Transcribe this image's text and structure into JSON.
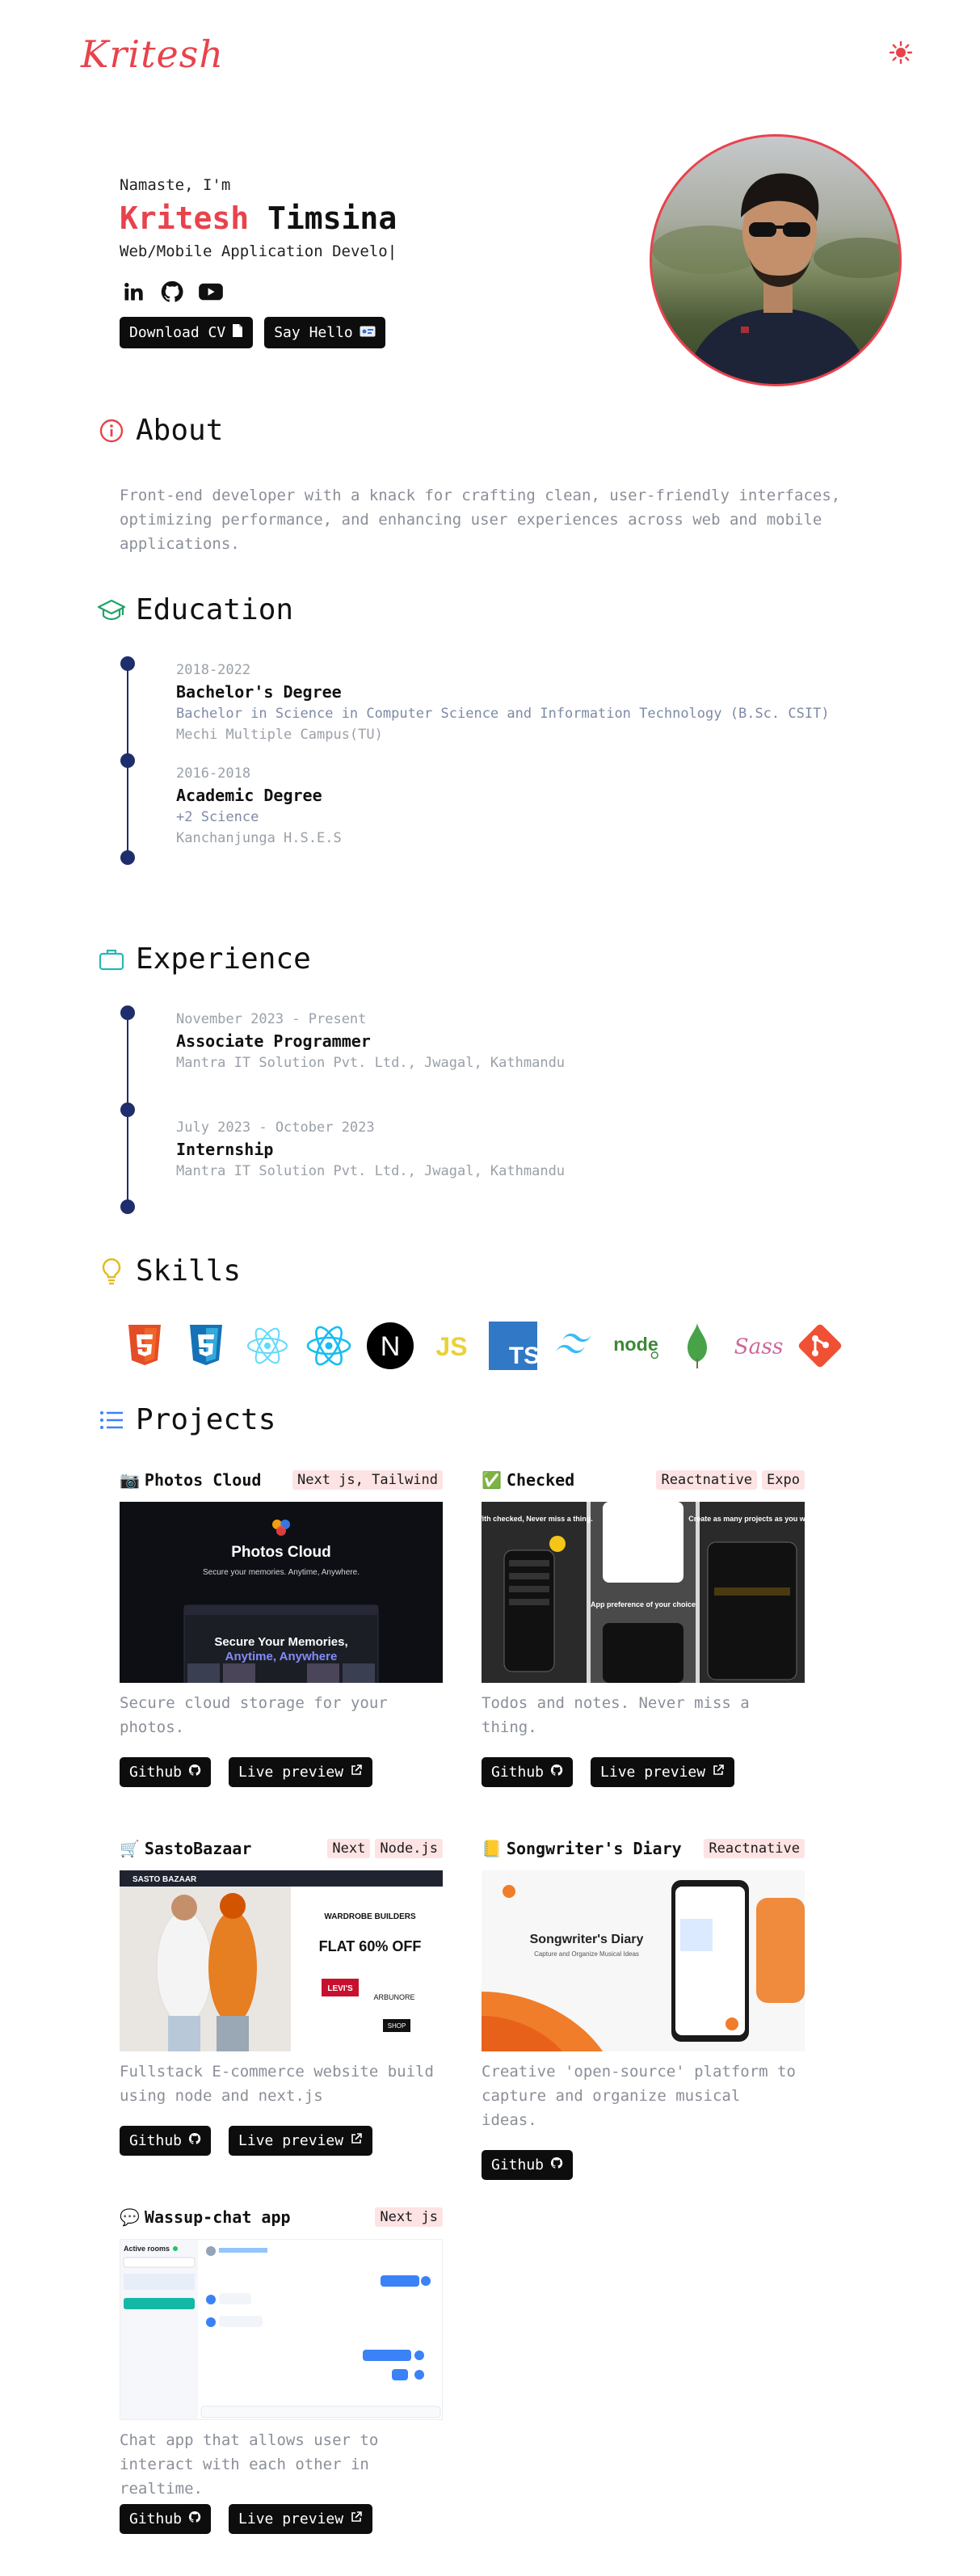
{
  "nav": {
    "logo": "Kritesh",
    "theme_icon": "sun-icon"
  },
  "hero": {
    "greeting": "Namaste, I'm",
    "first_name": "Kritesh",
    "last_name": "Timsina",
    "role": "Web/Mobile Application Develo",
    "socials": [
      "linkedin-icon",
      "github-icon",
      "youtube-icon"
    ],
    "download_cv": "Download CV",
    "say_hello": "Say Hello"
  },
  "about": {
    "title": "About",
    "text": "Front-end developer with a knack for crafting clean, user-friendly interfaces, optimizing performance, and enhancing user experiences across web and mobile applications."
  },
  "education": {
    "title": "Education",
    "items": [
      {
        "date": "2018-2022",
        "title": "Bachelor's Degree",
        "sub": "Bachelor in Science in Computer Science and Information Technology (B.Sc. CSIT)",
        "place": "Mechi Multiple Campus(TU)"
      },
      {
        "date": "2016-2018",
        "title": "Academic Degree",
        "sub": "+2 Science",
        "place": "Kanchanjunga H.S.E.S"
      }
    ]
  },
  "experience": {
    "title": "Experience",
    "items": [
      {
        "date": "November 2023 - Present",
        "title": "Associate Programmer",
        "place": "Mantra IT Solution Pvt. Ltd., Jwagal, Kathmandu"
      },
      {
        "date": "July 2023 - October 2023",
        "title": "Internship",
        "place": "Mantra IT Solution Pvt. Ltd., Jwagal, Kathmandu"
      }
    ]
  },
  "skills": {
    "title": "Skills",
    "items": [
      "html5-icon",
      "css3-icon",
      "react-icon",
      "react-native-icon",
      "nextjs-icon",
      "javascript-icon",
      "typescript-icon",
      "tailwind-icon",
      "nodejs-icon",
      "mongodb-icon",
      "sass-icon",
      "git-icon"
    ],
    "js_label": "JS",
    "ts_label": "TS",
    "next_label": "N",
    "node_label": "node",
    "sass_label": "Sass"
  },
  "projects": {
    "title": "Projects",
    "github_label": "Github",
    "live_label": "Live preview",
    "items": [
      {
        "emoji": "📷",
        "name": "Photos Cloud",
        "tags": [
          "Next js, Tailwind"
        ],
        "desc": "Secure cloud storage for your photos.",
        "has_live": true,
        "shot": {
          "title": "Photos Cloud",
          "subtitle": "Secure your memories. Anytime, Anywhere.",
          "hero1": "Secure Your Memories,",
          "hero2": "Anytime, Anywhere"
        }
      },
      {
        "emoji": "✅",
        "name": "Checked",
        "tags": [
          "Reactnative",
          "Expo"
        ],
        "desc": "Todos and notes. Never miss a thing.",
        "has_live": true,
        "shot": {
          "p1": "With checked, Never miss a thing.",
          "p2": "App preference of your choice",
          "p3": "Create as many projects as you wish"
        }
      },
      {
        "emoji": "🛒",
        "name": "SastoBazaar",
        "tags": [
          "Next",
          "Node.js"
        ],
        "desc": "Fullstack E-commerce website build using node and next.js",
        "has_live": true,
        "shot": {
          "brand": "SASTO BAZAAR",
          "headline": "WARDROBE BUILDERS",
          "offer": "FLAT 60% OFF",
          "brand1": "LEVI'S",
          "brand2": "ARBUNORE",
          "shop": "SHOP"
        }
      },
      {
        "emoji": "📒",
        "name": "Songwriter's Diary",
        "tags": [
          "Reactnative"
        ],
        "desc": "Creative 'open-source' platform to capture and organize musical ideas.",
        "has_live": false,
        "shot": {
          "title": "Songwriter's Diary",
          "subtitle": "Capture and Organize Musical Ideas"
        }
      },
      {
        "emoji": "💬",
        "name": "Wassup-chat app",
        "tags": [
          "Next js"
        ],
        "desc": "Chat app that allows user to interact with each other in realtime.",
        "has_live": true,
        "shot": {
          "rooms": "Active rooms"
        }
      }
    ]
  }
}
